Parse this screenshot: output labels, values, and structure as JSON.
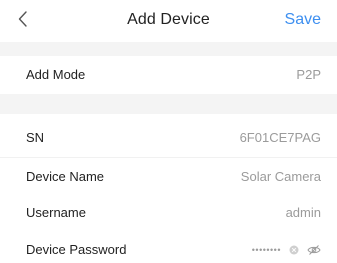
{
  "header": {
    "title": "Add Device",
    "save_label": "Save"
  },
  "rows": {
    "add_mode": {
      "label": "Add Mode",
      "value": "P2P"
    },
    "sn": {
      "label": "SN",
      "value": "6F01CE7PAG"
    },
    "device_name": {
      "label": "Device Name",
      "value": "Solar Camera"
    },
    "username": {
      "label": "Username",
      "value": "admin"
    },
    "device_password": {
      "label": "Device Password",
      "value": "••••••••"
    }
  },
  "colors": {
    "accent": "#3d8ff0",
    "section_band": "#f4f4f4",
    "value_text": "#9b9b9b"
  },
  "icons": {
    "back": "chevron-left-icon",
    "clear": "clear-circle-icon",
    "visibility": "eye-off-icon"
  }
}
